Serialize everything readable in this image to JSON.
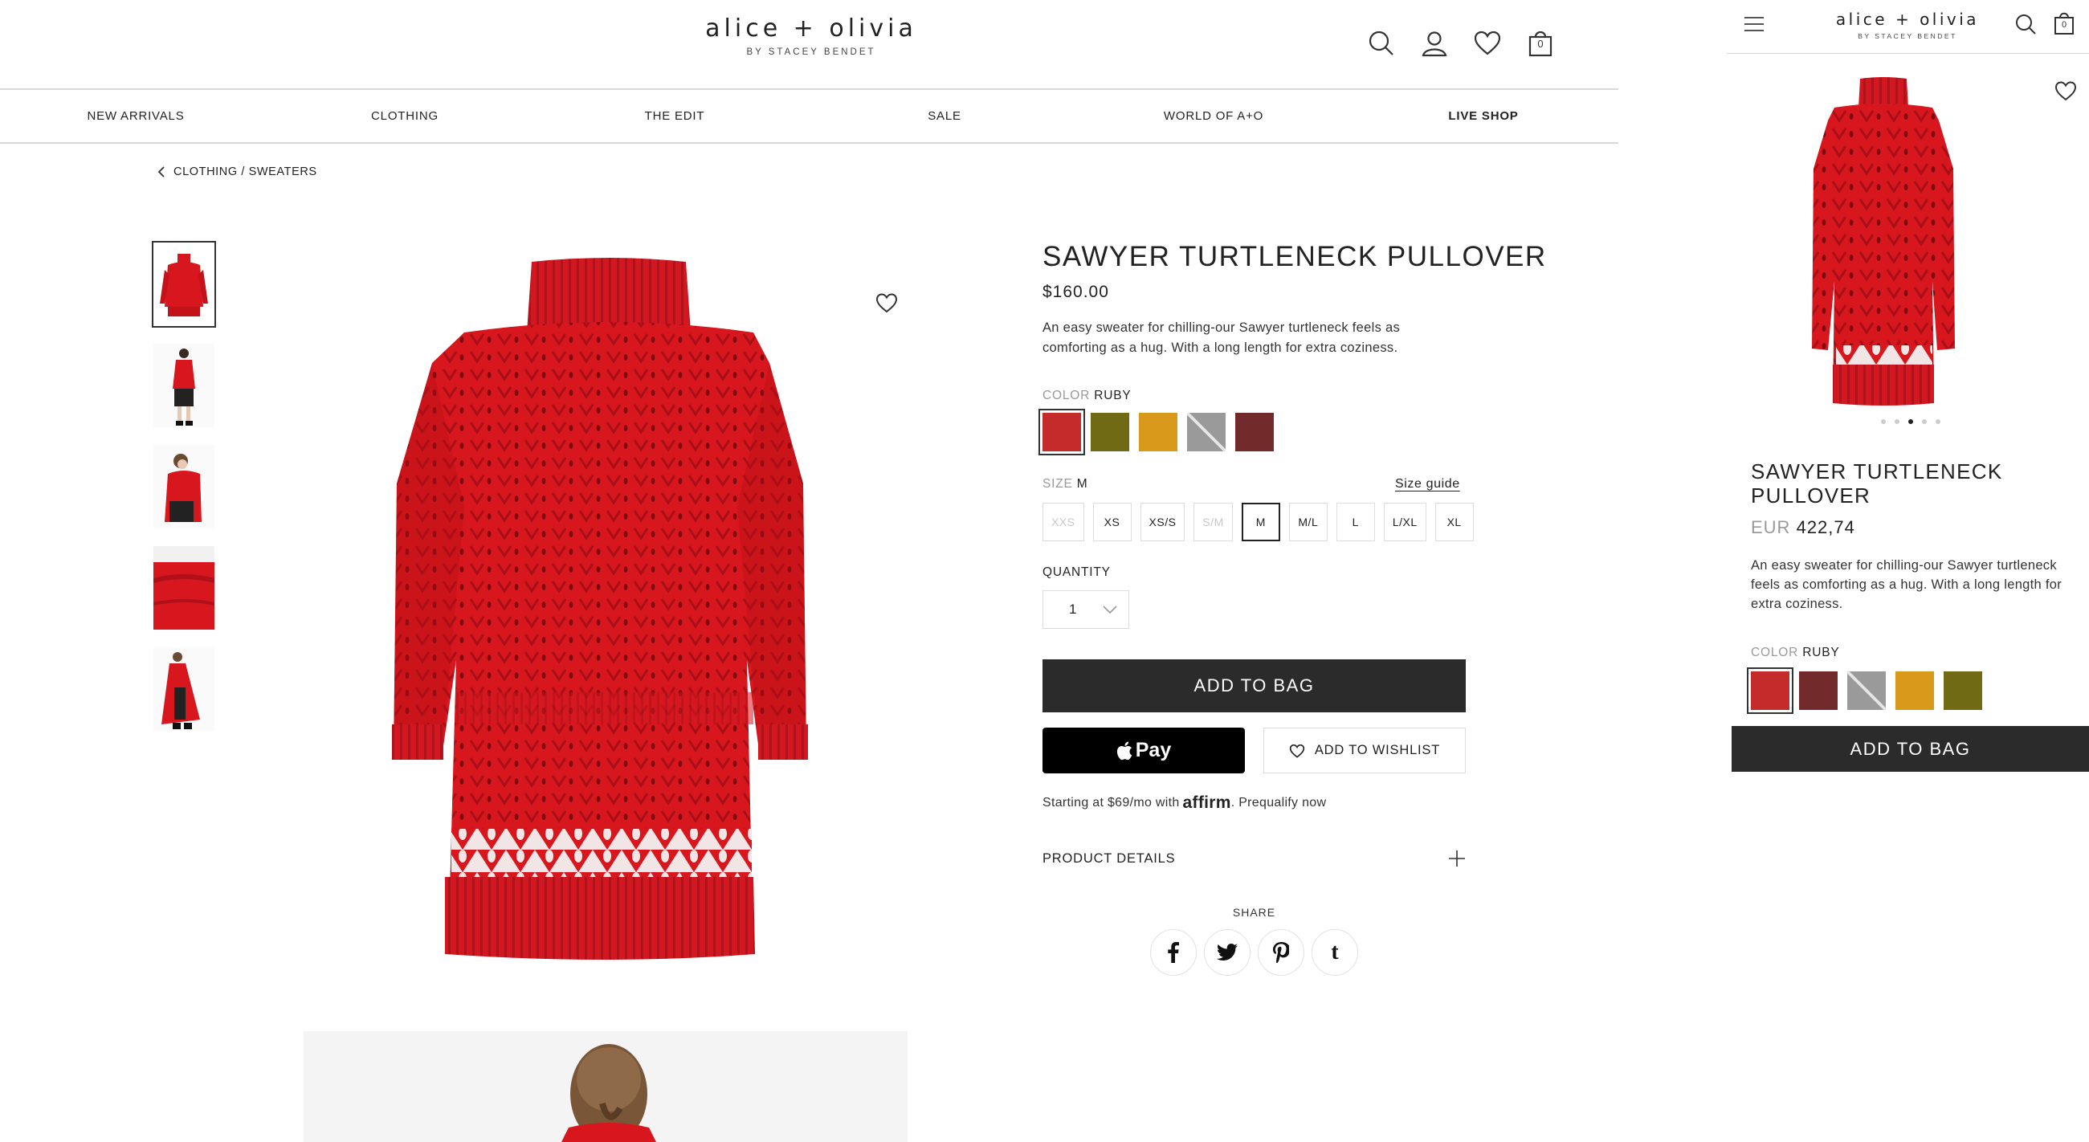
{
  "brand": {
    "name": "alice + olivia",
    "tagline": "BY STACEY BENDET"
  },
  "header": {
    "cart_count": "0"
  },
  "nav": {
    "items": [
      {
        "label": "NEW ARRIVALS"
      },
      {
        "label": "CLOTHING"
      },
      {
        "label": "THE EDIT"
      },
      {
        "label": "SALE"
      },
      {
        "label": "WORLD OF A+O"
      },
      {
        "label": "LIVE SHOP"
      }
    ]
  },
  "breadcrumb": {
    "label": "CLOTHING / SWEATERS"
  },
  "product": {
    "title": "SAWYER TURTLENECK PULLOVER",
    "price": "$160.00",
    "description": "An easy sweater for chilling-our Sawyer turtleneck feels as comforting as a hug. With a long length for extra coziness.",
    "color_label": "COLOR",
    "color_selected": "RUBY",
    "colors": [
      {
        "name": "Ruby",
        "hex": "#c42b2b"
      },
      {
        "name": "Olive",
        "hex": "#716a14"
      },
      {
        "name": "Mustard",
        "hex": "#d99a1b"
      },
      {
        "name": "Grey",
        "hex": "#9a9a9a"
      },
      {
        "name": "Burgundy",
        "hex": "#722a2a"
      }
    ],
    "size_label": "SIZE",
    "size_selected": "M",
    "size_guide": "Size guide",
    "sizes": [
      {
        "label": "XXS",
        "available": false
      },
      {
        "label": "XS",
        "available": true
      },
      {
        "label": "XS/S",
        "available": true
      },
      {
        "label": "S/M",
        "available": false
      },
      {
        "label": "M",
        "available": true
      },
      {
        "label": "M/L",
        "available": true
      },
      {
        "label": "L",
        "available": true
      },
      {
        "label": "L/XL",
        "available": true
      },
      {
        "label": "XL",
        "available": true
      }
    ],
    "quantity_label": "QUANTITY",
    "quantity": "1",
    "add_to_bag": "ADD TO BAG",
    "apple_pay": "Pay",
    "wishlist": "ADD TO WISHLIST",
    "affirm_prefix": "Starting at $69/mo with",
    "affirm_brand": "affirm",
    "affirm_suffix": ". Prequalify now",
    "details": "PRODUCT DETAILS",
    "share": "SHARE"
  },
  "mobile": {
    "title": "SAWYER TURTLENECK PULLOVER",
    "currency": "EUR",
    "price": "422,74",
    "description": "An easy sweater for chilling-our Sawyer turtleneck feels as comforting as a hug. With a long length for extra coziness.",
    "color_label": "COLOR",
    "color_selected": "RUBY",
    "colors": [
      {
        "name": "Ruby",
        "hex": "#c42b2b"
      },
      {
        "name": "Burgundy",
        "hex": "#722a2a"
      },
      {
        "name": "Grey",
        "hex": "#9a9a9a"
      },
      {
        "name": "Mustard",
        "hex": "#d99a1b"
      },
      {
        "name": "Olive",
        "hex": "#716a14"
      }
    ],
    "add_to_bag": "ADD TO BAG",
    "carousel_active": 3,
    "carousel_count": 5
  },
  "colors": {
    "sweater": "#d8161d",
    "sweater_dark": "#b0101a",
    "button_dark": "#2b2b2b"
  }
}
